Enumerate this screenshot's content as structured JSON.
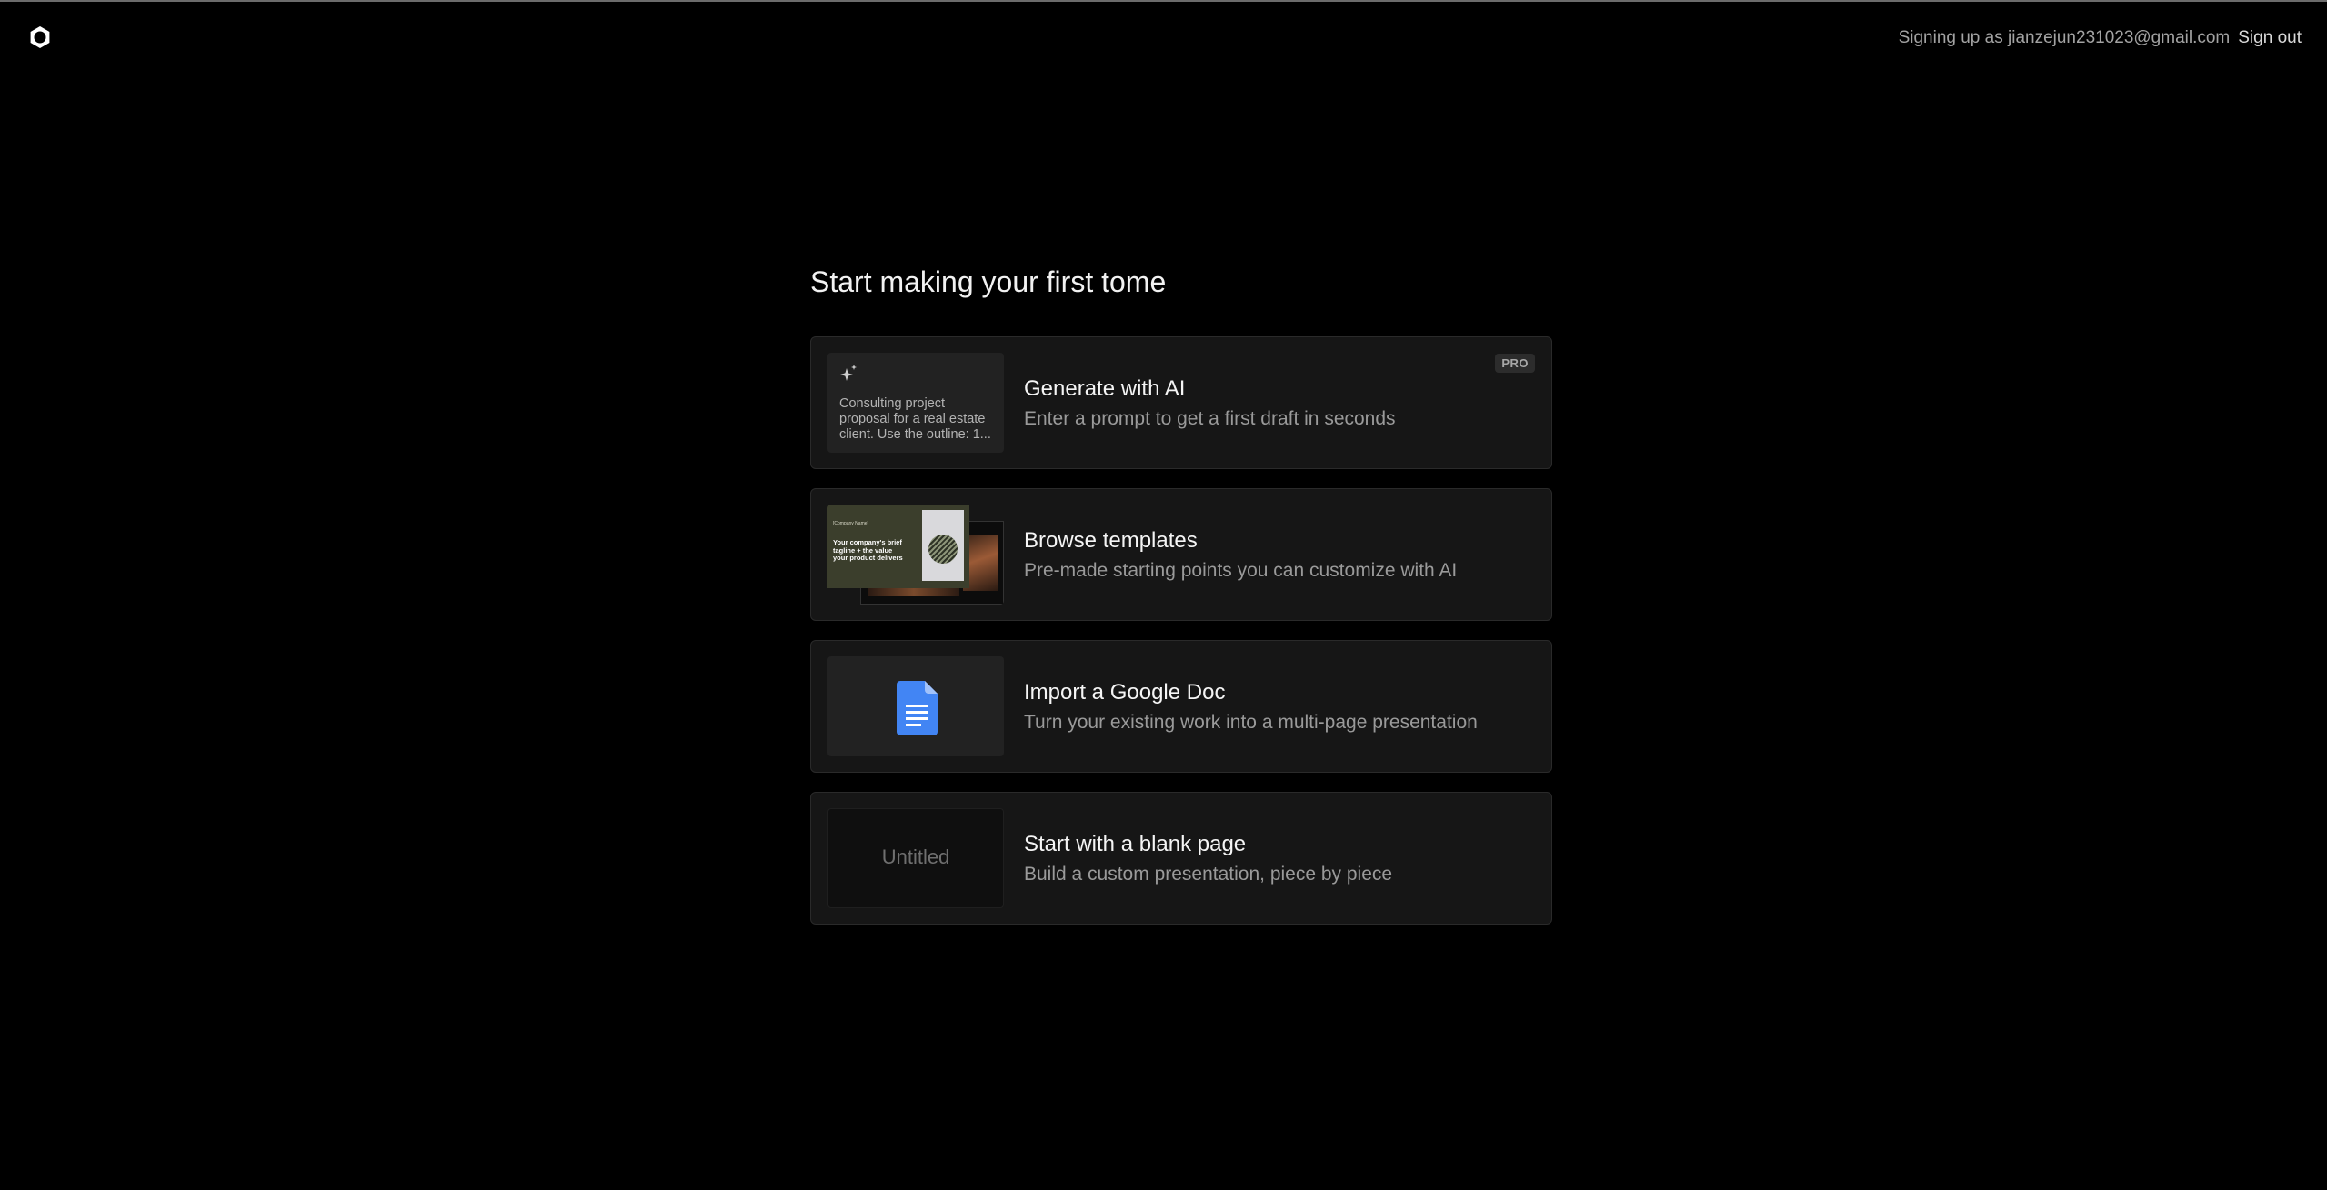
{
  "header": {
    "signing_up_as": "Signing up as jianzejun231023@gmail.com",
    "sign_out": "Sign out"
  },
  "main": {
    "title": "Start making your first tome",
    "options": [
      {
        "title": "Generate with AI",
        "description": "Enter a prompt to get a first draft in seconds",
        "badge": "PRO",
        "thumb_text": "Consulting project proposal for a real estate client. Use the outline: 1..."
      },
      {
        "title": "Browse templates",
        "description": "Pre-made starting points you can customize with AI",
        "thumb_company": "[Company Name]",
        "thumb_headline": "Your company's brief tagline + the value your product delivers"
      },
      {
        "title": "Import a Google Doc",
        "description": "Turn your existing work into a multi-page presentation",
        "icon": "google-docs-icon"
      },
      {
        "title": "Start with a blank page",
        "description": "Build a custom presentation, piece by piece",
        "thumb_text": "Untitled"
      }
    ]
  },
  "colors": {
    "background": "#000000",
    "card": "#161616",
    "google_docs_blue": "#4285F4"
  }
}
